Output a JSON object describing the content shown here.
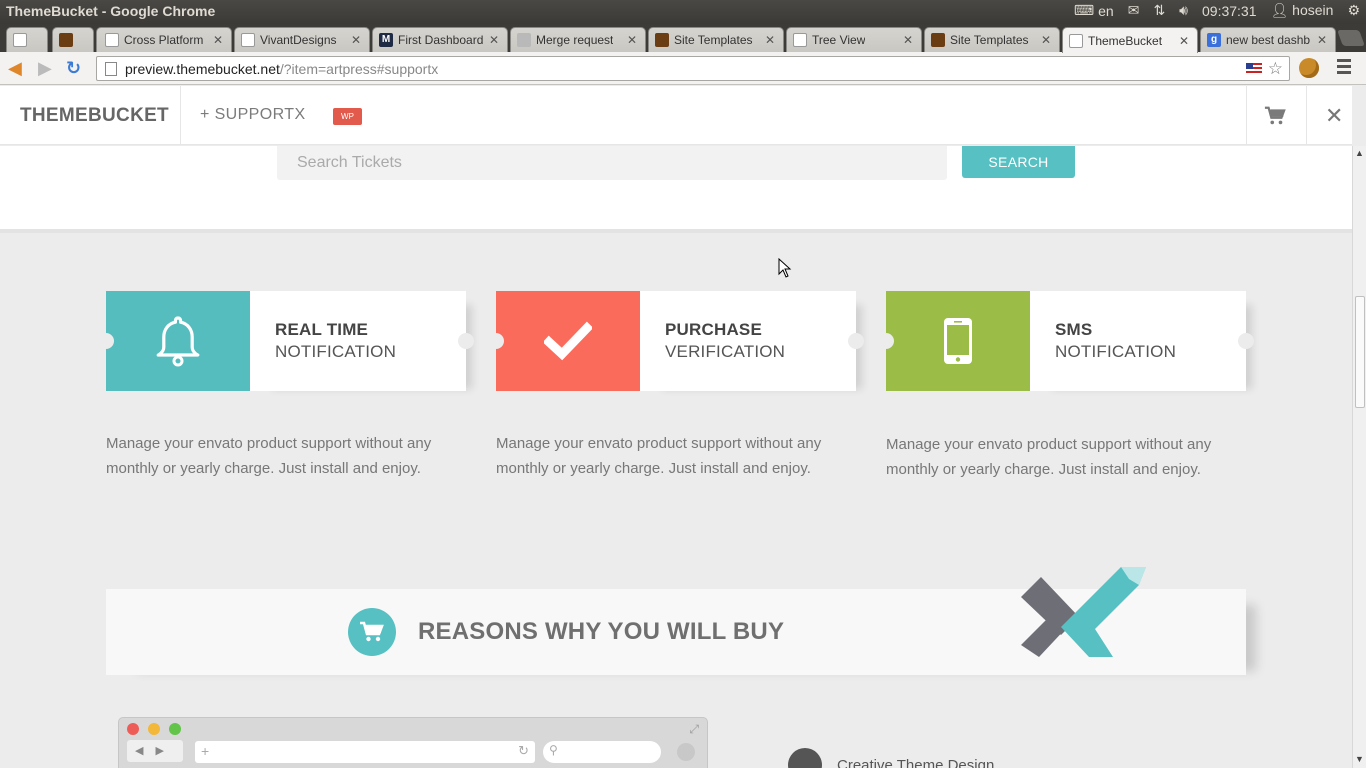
{
  "os": {
    "window_title": "ThemeBucket - Google Chrome",
    "keyboard_lang": "en",
    "time": "09:37:31",
    "user": "hosein"
  },
  "tabs": [
    {
      "label": "",
      "favicon": "page-icon"
    },
    {
      "label": "",
      "favicon": "themeforest-icon"
    },
    {
      "label": "Cross Platform",
      "favicon": "page-icon"
    },
    {
      "label": "VivantDesigns",
      "favicon": "page-icon"
    },
    {
      "label": "First Dashboard",
      "favicon": "m-icon"
    },
    {
      "label": "Merge request",
      "favicon": "gitlab-icon"
    },
    {
      "label": "Site Templates",
      "favicon": "themeforest-icon"
    },
    {
      "label": "Tree View",
      "favicon": "page-icon"
    },
    {
      "label": "Site Templates",
      "favicon": "themeforest-icon"
    },
    {
      "label": "ThemeBucket",
      "favicon": "page-icon",
      "active": true
    },
    {
      "label": "new best dashb",
      "favicon": "google-icon"
    }
  ],
  "address_bar": {
    "host": "preview.themebucket.net",
    "path": "/?item=artpress#supportx"
  },
  "site_header": {
    "brand": "THEMEBUCKET",
    "product": "+  SUPPORTX",
    "badge": "WP"
  },
  "search": {
    "placeholder": "Search Tickets",
    "button": "SEARCH"
  },
  "features": [
    {
      "title": "REAL TIME",
      "subtitle": "NOTIFICATION",
      "icon": "bell-icon",
      "color": "#56bdbf",
      "description": "Manage your envato product support without any monthly or yearly charge. Just install and enjoy."
    },
    {
      "title": "PURCHASE",
      "subtitle": "VERIFICATION",
      "icon": "checkmark-icon",
      "color": "#fb6b5b",
      "description": "Manage your envato product support without any monthly or yearly charge. Just install and enjoy."
    },
    {
      "title": "SMS",
      "subtitle": "NOTIFICATION",
      "icon": "mobile-phone-icon",
      "color": "#9bbc46",
      "description": "Manage your envato product support without any monthly or yearly charge. Just install and enjoy."
    }
  ],
  "reasons": {
    "title": "REASONS WHY YOU WILL BUY",
    "icon": "cart-icon"
  },
  "creative": {
    "label": "Creative Theme Design"
  },
  "colors": {
    "accent_teal": "#56c0c3",
    "accent_red": "#fb6b5b",
    "accent_green": "#9bbc46",
    "badge_red": "#e25a4c"
  }
}
